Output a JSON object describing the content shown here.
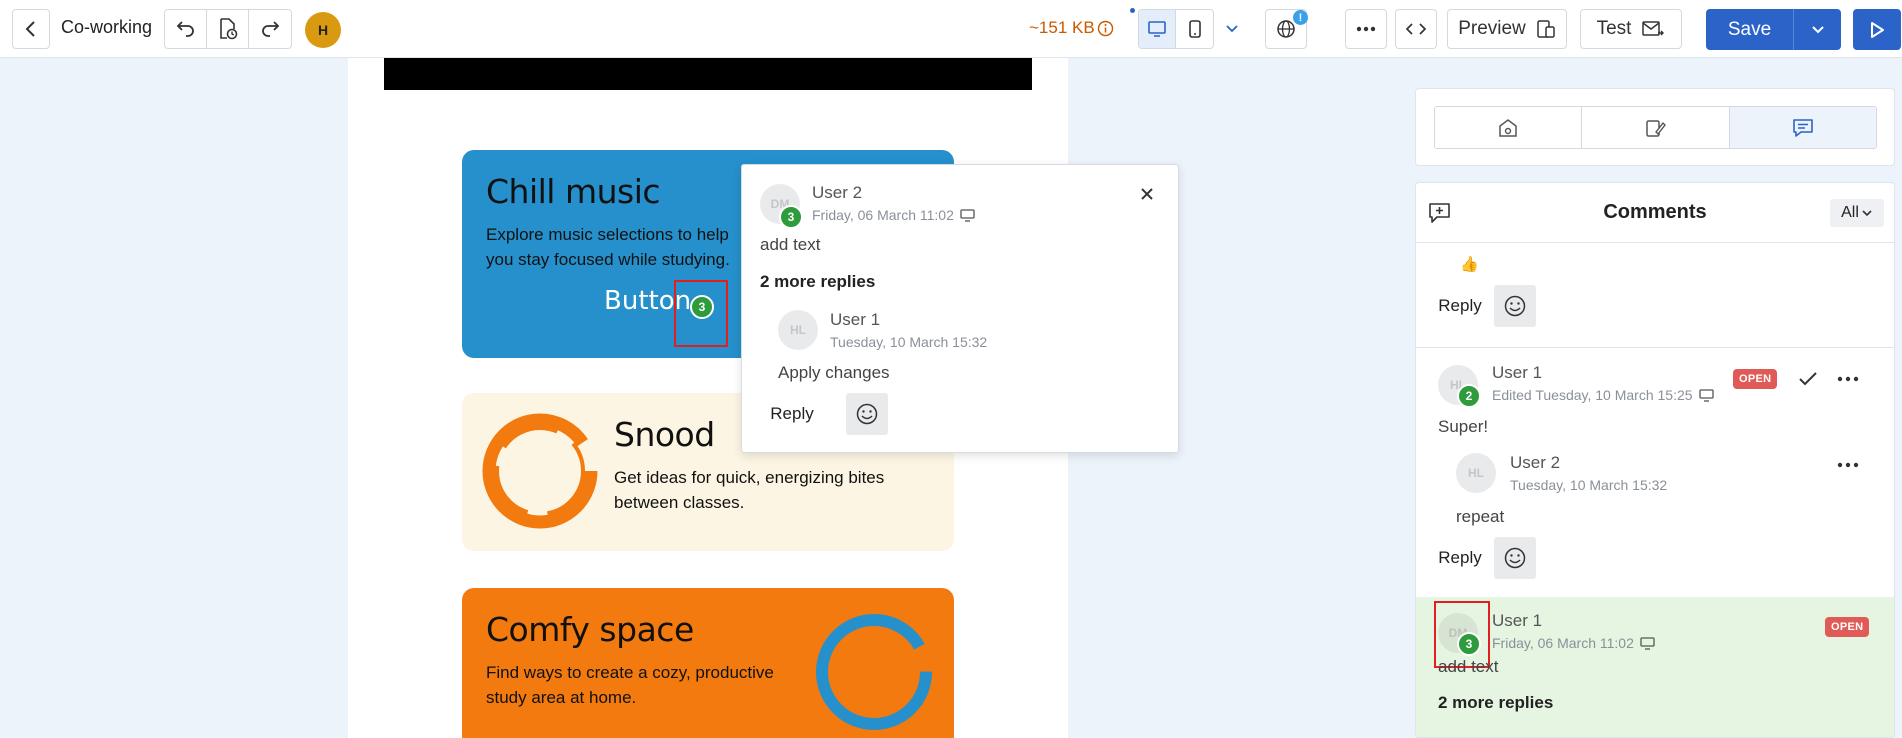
{
  "toolbar": {
    "title": "Co-working",
    "avatar_initial": "H",
    "size_text": "~151 KB",
    "preview_label": "Preview",
    "test_label": "Test",
    "save_label": "Save"
  },
  "email": {
    "cards": [
      {
        "title": "Chill music",
        "text": "Explore music selections to help you stay focused while studying.",
        "button": "Button"
      },
      {
        "title": "Snood",
        "text": "Get ideas for quick, energizing bites between classes."
      },
      {
        "title": "Comfy space",
        "text": "Find ways to create a cozy, productive study area at home."
      }
    ],
    "marker_count": "3"
  },
  "popup": {
    "author": "User 2",
    "initials": "DM",
    "count": "3",
    "date": "Friday, 06 March 11:02",
    "text": "add text",
    "more_replies": "2 more replies",
    "reply": {
      "author": "User 1",
      "initials": "HL",
      "date": "Tuesday, 10 March 15:32",
      "text": "Apply changes"
    },
    "reply_label": "Reply"
  },
  "panel": {
    "title": "Comments",
    "filter": "All",
    "thread0": {
      "emoji": "👍",
      "reply_label": "Reply"
    },
    "thread1": {
      "author": "User 1",
      "initials": "HL",
      "count": "2",
      "date": "Edited Tuesday, 10 March 15:25",
      "status": "OPEN",
      "text": "Super!",
      "reply": {
        "author": "User 2",
        "initials": "HL",
        "date": "Tuesday, 10 March 15:32",
        "text": "repeat"
      },
      "reply_label": "Reply"
    },
    "thread2": {
      "author": "User 1",
      "initials": "DM",
      "count": "3",
      "date": "Friday, 06 March 11:02",
      "status": "OPEN",
      "text": "add text",
      "more_replies": "2 more replies"
    }
  },
  "colors": {
    "accent": "#2b63c9",
    "open_badge": "#e05a57",
    "count_badge": "#2e9b3c"
  }
}
